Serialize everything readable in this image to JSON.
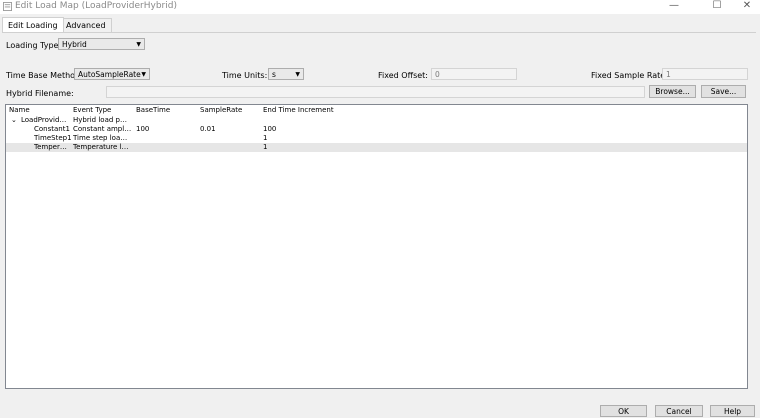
{
  "window": {
    "title": "Edit Load Map (LoadProviderHybrid)",
    "minimize_glyph": "—",
    "maximize_glyph": "☐",
    "close_glyph": "✕"
  },
  "tabs": [
    {
      "label": "Edit Loading",
      "active": true
    },
    {
      "label": "Advanced",
      "active": false
    }
  ],
  "form": {
    "loading_type_label": "Loading Type:",
    "loading_type_value": "Hybrid",
    "time_base_label": "Time Base Method:",
    "time_base_value": "AutoSampleRate",
    "time_units_label": "Time Units:",
    "time_units_value": "s",
    "fixed_offset_label": "Fixed Offset:",
    "fixed_offset_value": "0",
    "fixed_sample_rate_label": "Fixed Sample Rate:",
    "fixed_sample_rate_value": "1",
    "hybrid_filename_label": "Hybrid Filename:",
    "hybrid_filename_value": "",
    "browse_label": "Browse...",
    "save_label": "Save..."
  },
  "table": {
    "columns": [
      "Name",
      "Event Type",
      "BaseTime",
      "SampleRate",
      "End Time Increment"
    ],
    "rows": [
      {
        "expander": "⌄",
        "name": "LoadProvid…",
        "event_type": "Hybrid load p…",
        "base_time": "",
        "sample_rate": "",
        "end_time_increment": "",
        "selected": false
      },
      {
        "expander": "",
        "name": "Constant1",
        "event_type": "Constant ampl…",
        "base_time": "100",
        "sample_rate": "0.01",
        "end_time_increment": "100",
        "selected": false
      },
      {
        "expander": "",
        "name": "TimeStep1",
        "event_type": "Time step loa…",
        "base_time": "",
        "sample_rate": "",
        "end_time_increment": "1",
        "selected": false
      },
      {
        "expander": "",
        "name": "Temper…",
        "event_type": "Temperature l…",
        "base_time": "",
        "sample_rate": "",
        "end_time_increment": "1",
        "selected": true
      }
    ]
  },
  "footer": {
    "ok_label": "OK",
    "cancel_label": "Cancel",
    "help_label": "Help"
  }
}
